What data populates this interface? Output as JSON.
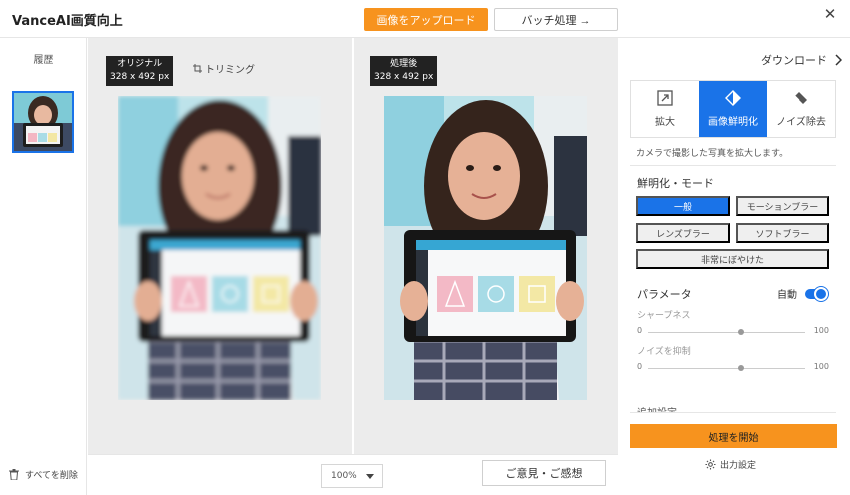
{
  "header": {
    "title": "VanceAI画質向上",
    "upload_label": "画像をアップロード",
    "batch_label": "バッチ処理 →"
  },
  "history": {
    "title": "履歴",
    "delete_all_label": "すべてを削除"
  },
  "canvas": {
    "original_badge": "オリジナル",
    "original_size": "328 x 492 px",
    "trim_label": "トリミング",
    "processed_badge": "処理後",
    "processed_size": "328 x 492 px",
    "zoom_value": "100%",
    "feedback_label": "ご意見・ご感想"
  },
  "panel": {
    "download_label": "ダウンロード",
    "tabs": [
      {
        "label": "拡大",
        "icon": "enlarge-icon"
      },
      {
        "label": "画像鮮明化",
        "icon": "sharpen-icon"
      },
      {
        "label": "ノイズ除去",
        "icon": "eraser-icon"
      }
    ],
    "description": "カメラで撮影した写真を拡大します。",
    "mode_title": "鮮明化・モード",
    "modes": [
      "一般",
      "モーションブラー",
      "レンズブラー",
      "ソフトブラー",
      "非常にぼやけた"
    ],
    "params_title": "パラメータ",
    "auto_label": "自動",
    "sharpness_label": "シャープネス",
    "sharpness": {
      "min": "0",
      "max": "100",
      "value": 0.59
    },
    "denoise_label": "ノイズを抑制",
    "denoise": {
      "min": "0",
      "max": "100",
      "value": 0.59
    },
    "more_settings": "追加設定",
    "start_label": "処理を開始",
    "output_label": "出力設定"
  },
  "colors": {
    "accent_blue": "#1a73e8",
    "accent_orange": "#f7931e"
  }
}
